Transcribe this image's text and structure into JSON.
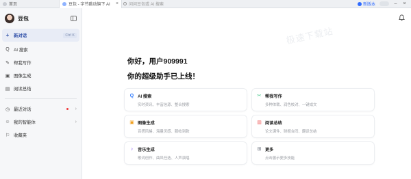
{
  "tabs": [
    {
      "label": "首页"
    },
    {
      "label": "豆包 - 字节跳动旗下 AI"
    }
  ],
  "address": {
    "placeholder": "问问豆包或 AI 搜索"
  },
  "browser": {
    "new_version": "新版本"
  },
  "sidebar": {
    "brand": "豆包",
    "new_chat": {
      "label": "新对话",
      "shortcut": "Ctrl K"
    },
    "tools": [
      {
        "label": "AI 搜索",
        "icon": "search-icon"
      },
      {
        "label": "帮我写作",
        "icon": "pen-icon"
      },
      {
        "label": "图像生成",
        "icon": "image-icon"
      },
      {
        "label": "阅读总结",
        "icon": "book-icon"
      }
    ],
    "sections": [
      {
        "label": "最近对话",
        "icon": "clock-icon"
      },
      {
        "label": "我的智能体",
        "icon": "bot-icon"
      },
      {
        "label": "收藏夹",
        "icon": "bookmark-icon"
      }
    ]
  },
  "main": {
    "watermark": "极速下载站",
    "greeting": "你好，用户909991",
    "subtitle": "你的超级助手已上线！",
    "cards": [
      {
        "title": "AI 搜索",
        "desc": "实时资讯、丰富信源、整合搜索",
        "icon": "search-icon",
        "color": "#2f7bff"
      },
      {
        "title": "帮我写作",
        "desc": "多种体裁、润色校对、一键成文",
        "icon": "pen-icon",
        "color": "#2dbf7a"
      },
      {
        "title": "图像生成",
        "desc": "百搭风格、海量灵感、服帖到款",
        "icon": "image-icon",
        "color": "#f0a020"
      },
      {
        "title": "阅读总结",
        "desc": "论文课件、财报合同、翻译总结",
        "icon": "book-icon",
        "color": "#f05b5b"
      },
      {
        "title": "音乐生成",
        "desc": "歌词创作、曲风任选、人声演唱",
        "icon": "music-icon",
        "color": "#8b5cf6"
      },
      {
        "title": "更多",
        "desc": "点击展示更多技能",
        "icon": "grid-icon",
        "color": "#8a8f99"
      }
    ]
  }
}
